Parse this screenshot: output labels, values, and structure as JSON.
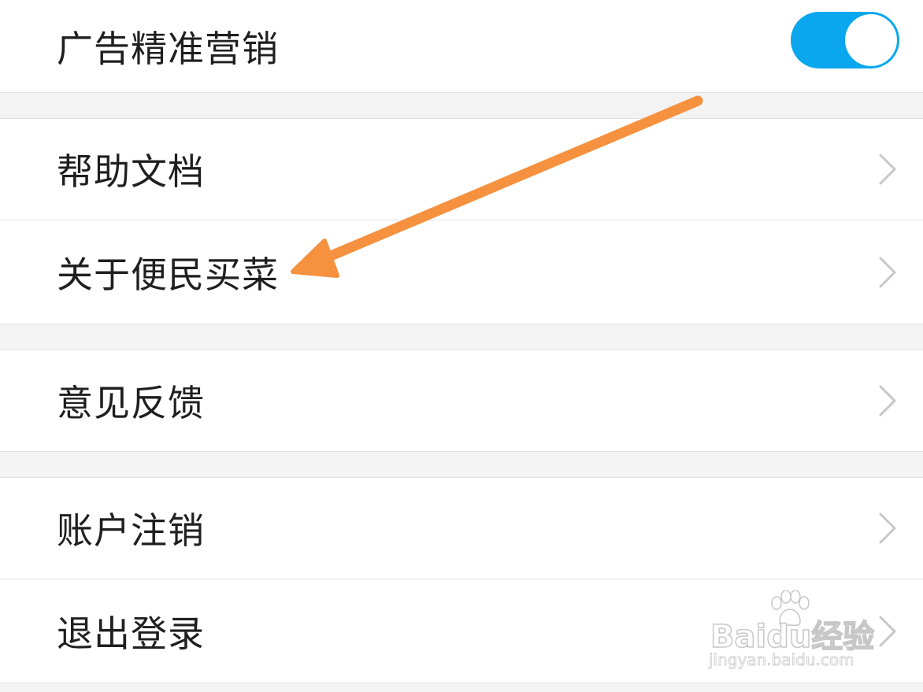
{
  "settings": {
    "ad_marketing": {
      "label": "广告精准营销",
      "toggle_on": true
    },
    "items": [
      {
        "label": "帮助文档"
      },
      {
        "label": "关于便民买菜"
      },
      {
        "label": "意见反馈"
      },
      {
        "label": "账户注销"
      },
      {
        "label": "退出登录"
      }
    ]
  },
  "annotation": {
    "arrow_color": "#f5913f",
    "target": "关于便民买菜"
  },
  "watermark": {
    "brand": "Baidu经验",
    "url": "jingyan.baidu.com"
  },
  "colors": {
    "toggle_on": "#0aa7ef",
    "background": "#f3f3f3",
    "row": "#ffffff",
    "text": "#1f1f1f",
    "chevron": "#c7c7c7"
  }
}
